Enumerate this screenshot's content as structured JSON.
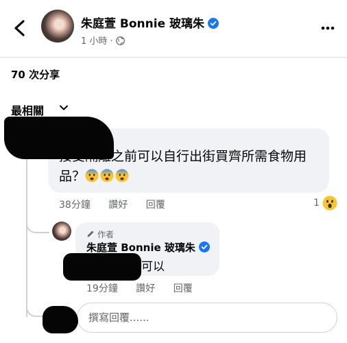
{
  "header": {
    "author": "朱庭萱 Bonnie 玻璃朱",
    "time": "1 小時",
    "separator": "·",
    "icons": [
      "back-arrow-icon",
      "verified-badge-icon",
      "globe-icon",
      "more-options-icon"
    ]
  },
  "post": {
    "shares": "70 次分享",
    "sort_label": "最相關"
  },
  "comment1": {
    "text_line1": "接受隔離之前可以自行出街買齊所需食物用",
    "text_line2": "品？",
    "emoji": [
      "anxious-face-emoji",
      "anxious-face-emoji",
      "anxious-face-emoji"
    ],
    "time": "38分鐘",
    "like_label": "讚好",
    "reply_label": "回覆",
    "reaction_count": "1",
    "reaction_icon": "wow-reaction-icon"
  },
  "reply1": {
    "author_tag": "作者",
    "author": "朱庭萱 Bonnie 玻璃朱",
    "text": "可以",
    "time": "19分鐘",
    "like_label": "讚好",
    "reply_label": "回覆"
  },
  "composer": {
    "placeholder": "撰寫回覆......"
  },
  "colors": {
    "verified": "#1877f2",
    "bubble": "#f0f2f5",
    "secondary_text": "#65676b",
    "thread_line": "#ced0d4"
  }
}
